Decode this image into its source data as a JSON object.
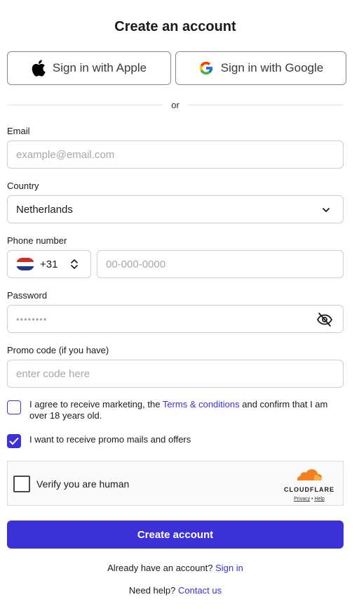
{
  "header": {
    "title": "Create an account"
  },
  "sso": {
    "apple_label": "Sign in with Apple",
    "google_label": "Sign in with Google"
  },
  "divider": {
    "text": "or"
  },
  "email": {
    "label": "Email",
    "placeholder": "example@email.com"
  },
  "country": {
    "label": "Country",
    "value": "Netherlands"
  },
  "phone": {
    "label": "Phone number",
    "code": "+31",
    "placeholder": "00-000-0000",
    "flag_colors": [
      "#d52b1e",
      "#ffffff",
      "#1e3a8a"
    ]
  },
  "password": {
    "label": "Password",
    "masked_value": "••••••••"
  },
  "promo": {
    "label": "Promo code (if you have)",
    "placeholder": "enter code here"
  },
  "consent": {
    "marketing_prefix": "I agree to receive marketing, the ",
    "marketing_link": "Terms & conditions",
    "marketing_suffix": " and confirm that I am over 18 years old.",
    "marketing_checked": false,
    "promo_text": "I want to receive promo mails and offers",
    "promo_checked": true
  },
  "captcha": {
    "text": "Verify you are human",
    "brand": "CLOUDFLARE",
    "privacy": "Privacy",
    "sep": "•",
    "help": "Help"
  },
  "submit": {
    "label": "Create account"
  },
  "footer": {
    "signin_prompt": "Already have an account?",
    "signin_link": "Sign in",
    "help_prompt": "Need help?",
    "help_link": "Contact us"
  },
  "colors": {
    "accent": "#3b31d6",
    "cloudflare_orange": "#f38020"
  }
}
